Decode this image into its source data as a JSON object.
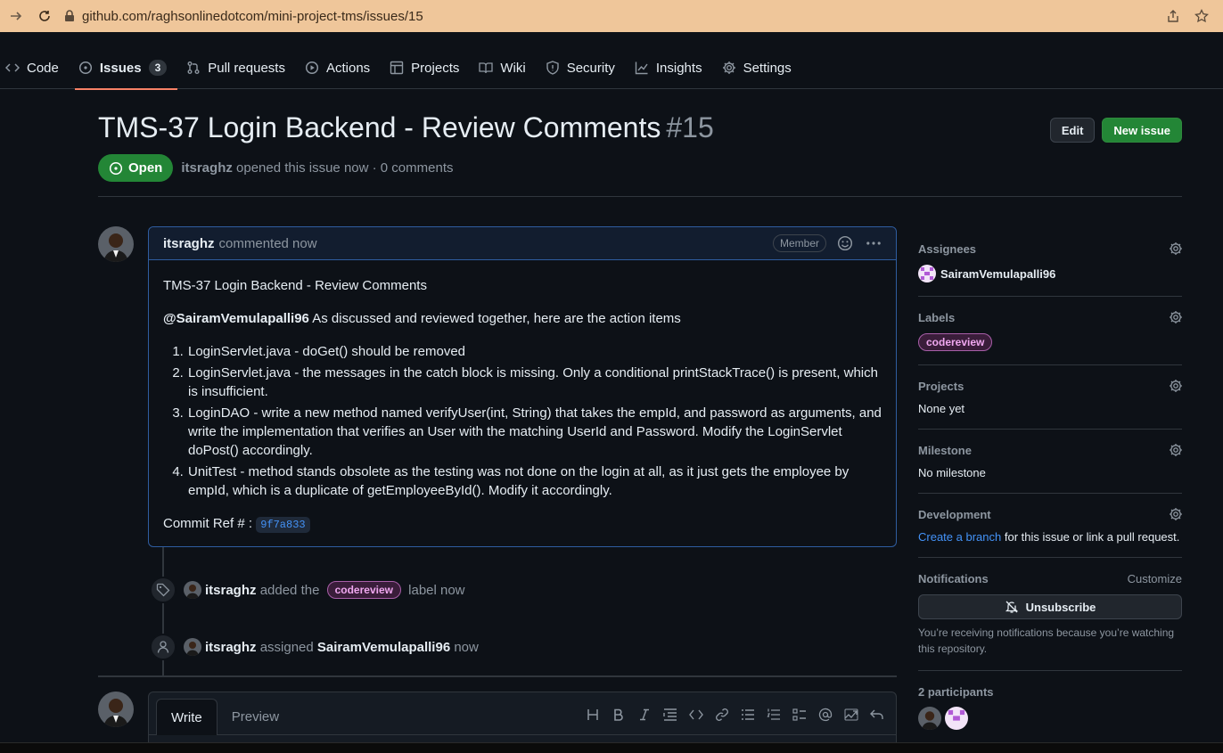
{
  "browser": {
    "url": "github.com/raghsonlinedotcom/mini-project-tms/issues/15"
  },
  "repo_nav": {
    "tabs": [
      {
        "label": "Code",
        "icon": "code-icon"
      },
      {
        "label": "Issues",
        "icon": "issue-icon",
        "counter": "3",
        "active": true
      },
      {
        "label": "Pull requests",
        "icon": "pull-request-icon"
      },
      {
        "label": "Actions",
        "icon": "play-icon"
      },
      {
        "label": "Projects",
        "icon": "table-icon"
      },
      {
        "label": "Wiki",
        "icon": "book-icon"
      },
      {
        "label": "Security",
        "icon": "shield-icon"
      },
      {
        "label": "Insights",
        "icon": "graph-icon"
      },
      {
        "label": "Settings",
        "icon": "gear-icon"
      }
    ]
  },
  "issue": {
    "title": "TMS-37 Login Backend - Review Comments",
    "number": "#15",
    "state": "Open",
    "author": "itsraghz",
    "meta": "opened this issue now · 0 comments",
    "edit_label": "Edit",
    "new_issue_label": "New issue"
  },
  "comment": {
    "author": "itsraghz",
    "when": "commented now",
    "role": "Member",
    "heading": "TMS-37 Login Backend - Review Comments",
    "mention": "@SairamVemulapalli96",
    "intro": " As discussed and reviewed together, here are the action items",
    "items": [
      "LoginServlet.java - doGet() should be removed",
      "LoginServlet.java - the messages in the catch block is missing. Only a conditional printStackTrace() is present, which is insufficient.",
      "LoginDAO - write a new method named verifyUser(int, String) that takes the empId, and password as arguments, and write the implementation that verifies an User with the matching UserId and Password. Modify the LoginServlet doPost() accordingly.",
      "UnitTest - method stands obsolete as the testing was not done on the login at all, as it just gets the employee by empId, which is a duplicate of getEmployeeById(). Modify it accordingly."
    ],
    "commit_label": "Commit Ref # : ",
    "commit_sha": "9f7a833"
  },
  "timeline": {
    "label_event": {
      "actor": "itsraghz",
      "verb": "added the",
      "label": "codereview",
      "suffix": "label now"
    },
    "assign_event": {
      "actor": "itsraghz",
      "verb": "assigned",
      "assignee": "SairamVemulapalli96",
      "suffix": "now"
    }
  },
  "composer": {
    "write_tab": "Write",
    "preview_tab": "Preview",
    "toolbar": [
      "heading-icon",
      "bold-icon",
      "italic-icon",
      "quote-icon",
      "code-icon",
      "link-icon",
      "unordered-list-icon",
      "ordered-list-icon",
      "task-list-icon",
      "mention-icon",
      "reference-icon",
      "undo-icon"
    ]
  },
  "sidebar": {
    "assignees": {
      "title": "Assignees",
      "value": "SairamVemulapalli96"
    },
    "labels": {
      "title": "Labels",
      "value": "codereview"
    },
    "projects": {
      "title": "Projects",
      "value": "None yet"
    },
    "milestone": {
      "title": "Milestone",
      "value": "No milestone"
    },
    "development": {
      "title": "Development",
      "link": "Create a branch",
      "rest": " for this issue or link a pull request."
    },
    "notifications": {
      "title": "Notifications",
      "customize": "Customize",
      "button": "Unsubscribe",
      "note": "You’re receiving notifications because you’re watching this repository."
    },
    "participants": {
      "title": "2 participants"
    }
  },
  "colors": {
    "background": "#0d1117",
    "accent_green": "#238636",
    "link_blue": "#4493f8",
    "tab_underline": "#f78166",
    "browser_bar": "#efc69a",
    "label_pink": "#a85ea8"
  }
}
